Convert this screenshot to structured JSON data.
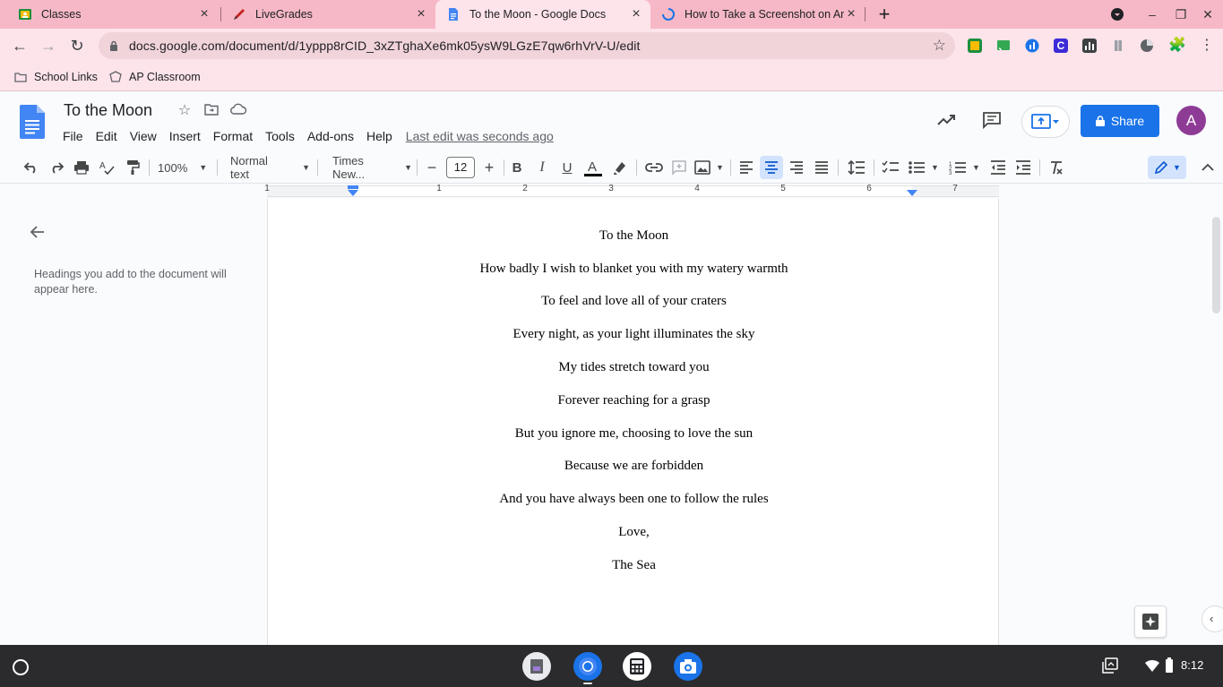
{
  "browser": {
    "tabs": [
      {
        "title": "Classes",
        "icon": "google-classroom-icon",
        "active": false
      },
      {
        "title": "LiveGrades",
        "icon": "livegrades-icon",
        "active": false
      },
      {
        "title": "To the Moon - Google Docs",
        "icon": "google-docs-icon",
        "active": true
      },
      {
        "title": "How to Take a Screenshot on An",
        "icon": "loading-spinner-icon",
        "active": false
      }
    ],
    "url": "docs.google.com/document/d/1yppp8rCID_3xZTghaXe6mk05ysW9LGzE7qw6rhVrV-U/edit",
    "bookmarks": [
      {
        "label": "School Links",
        "icon": "folder-icon"
      },
      {
        "label": "AP Classroom",
        "icon": "ap-classroom-icon"
      }
    ]
  },
  "docs": {
    "title": "To the Moon",
    "menu": [
      "File",
      "Edit",
      "View",
      "Insert",
      "Format",
      "Tools",
      "Add-ons",
      "Help"
    ],
    "last_edit": "Last edit was seconds ago",
    "share_label": "Share",
    "avatar_letter": "A",
    "toolbar": {
      "zoom": "100%",
      "style": "Normal text",
      "font": "Times New...",
      "font_size": "12",
      "bold": "B",
      "italic": "I",
      "underline": "U"
    },
    "ruler_numbers": [
      "1",
      "1",
      "2",
      "3",
      "4",
      "5",
      "6",
      "7"
    ],
    "outline_hint": "Headings you add to the document will appear here.",
    "body_lines": [
      "To the Moon",
      "How badly I wish to blanket you with my watery warmth",
      "To feel and love all of your craters",
      "Every night, as your light illuminates the sky",
      "My tides stretch toward you",
      "Forever reaching for a grasp",
      "But you ignore me, choosing to love the sun",
      "Because we are forbidden",
      "And you have always been one to follow the rules",
      "Love,",
      "The Sea"
    ]
  },
  "shelf": {
    "clock": "8:12"
  },
  "colors": {
    "tabstrip": "#f6b8c6",
    "toolbar": "#fde3ea",
    "docs_blue": "#1a73e8",
    "avatar": "#8e3b96"
  }
}
